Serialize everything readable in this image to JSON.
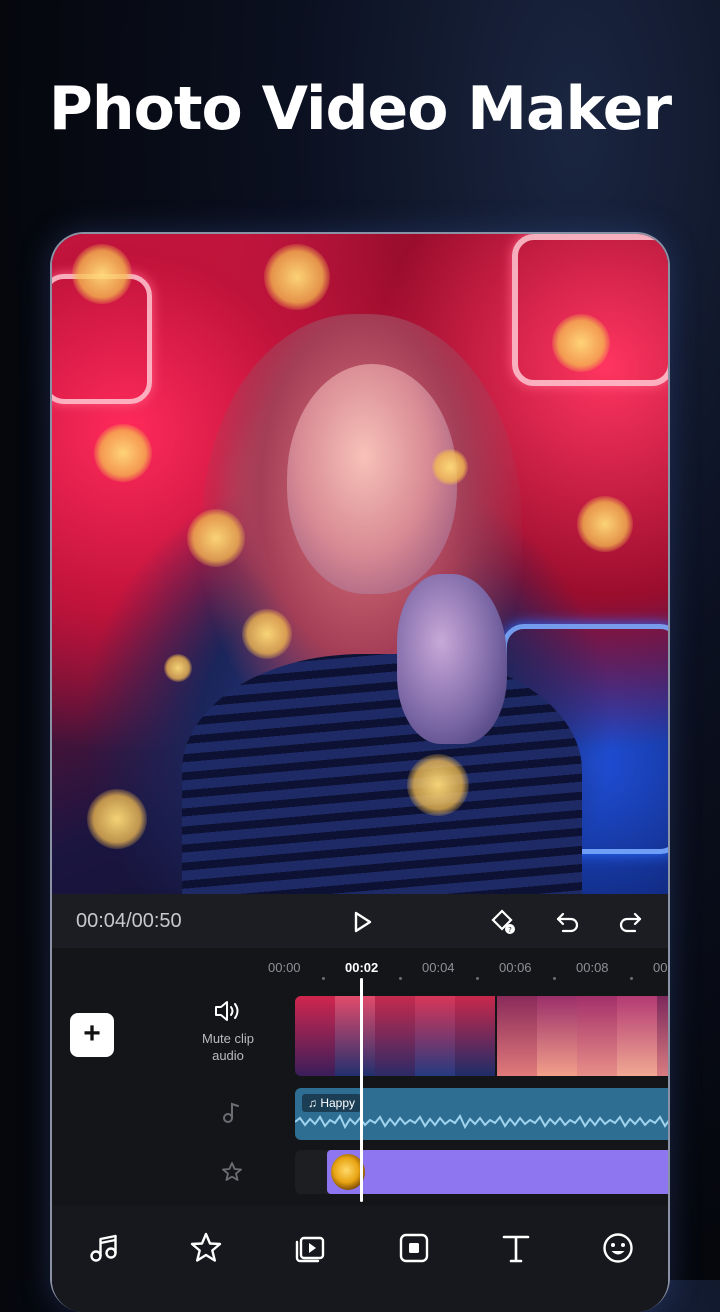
{
  "headline": "Photo Video Maker",
  "player": {
    "current_time": "00:04",
    "separator": "/",
    "duration": "00:50"
  },
  "timeline": {
    "ticks": [
      "00:00",
      "00:02",
      "00:04",
      "00:06",
      "00:08",
      "00:"
    ],
    "active_tick": "00:02",
    "mute_label_line1": "Mute clip",
    "mute_label_line2": "audio",
    "audio_clip_label": "Happy"
  },
  "colors": {
    "accent_purple": "#8d76ef",
    "audio_blue": "#2f6e93"
  },
  "icons": {
    "play": "play-icon",
    "keyframe": "keyframe-icon",
    "undo": "undo-icon",
    "redo": "redo-icon",
    "add": "plus-icon",
    "mute": "speaker-icon",
    "music_row": "music-note-icon",
    "sticker_row": "star-icon",
    "bottom_tools": [
      "music-icon",
      "star-icon",
      "media-icon",
      "stop-icon",
      "text-icon",
      "emoji-icon"
    ]
  }
}
